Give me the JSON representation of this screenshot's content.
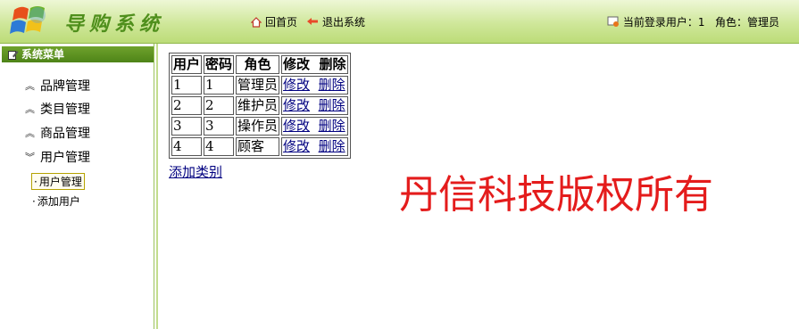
{
  "header": {
    "app_title": "导购系统",
    "nav_home": "回首页",
    "nav_exit": "退出系统",
    "current_user": "当前登录用户：1   角色：管理员"
  },
  "sidebar": {
    "menu_title": "系统菜单",
    "items": [
      {
        "label": "品牌管理",
        "state": "collapsed"
      },
      {
        "label": "类目管理",
        "state": "collapsed"
      },
      {
        "label": "商品管理",
        "state": "collapsed"
      },
      {
        "label": "用户管理",
        "state": "expanded"
      }
    ],
    "sub_items": [
      {
        "label": "用户管理",
        "active": true
      },
      {
        "label": "添加用户",
        "active": false
      }
    ]
  },
  "table": {
    "headers": [
      "用户",
      "密码",
      "角色",
      "修改",
      "删除"
    ],
    "rows": [
      [
        "1",
        "1",
        "管理员",
        "修改",
        "删除"
      ],
      [
        "2",
        "2",
        "维护员",
        "修改",
        "删除"
      ],
      [
        "3",
        "3",
        "操作员",
        "修改",
        "删除"
      ],
      [
        "4",
        "4",
        "顾客",
        "修改",
        "删除"
      ]
    ]
  },
  "add_link": "添加类别",
  "watermark": "丹信科技版权所有",
  "colors": {
    "header_green": "#cfe79a",
    "menu_title_green": "#5e9422",
    "link": "#000080",
    "watermark": "#e41c1c"
  },
  "icons": [
    "logo-icon",
    "home-icon",
    "exit-icon",
    "user-icon",
    "menu-edit-icon",
    "chevron-up-icon",
    "chevron-down-icon"
  ]
}
